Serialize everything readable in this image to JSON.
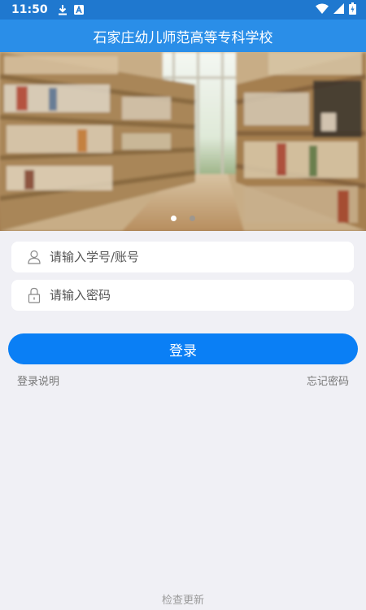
{
  "status_bar": {
    "time": "11:50",
    "icons": [
      "download-icon",
      "a-badge-icon",
      "wifi-icon",
      "signal-icon",
      "battery-icon"
    ]
  },
  "app_bar": {
    "title": "石家庄幼儿师范高等专科学校"
  },
  "banner": {
    "slide_count": 2,
    "active_slide": 0
  },
  "login_form": {
    "account_placeholder": "请输入学号/账号",
    "account_value": "",
    "password_placeholder": "请输入密码",
    "password_value": "",
    "login_button": "登录",
    "login_help_link": "登录说明",
    "forgot_password_link": "忘记密码"
  },
  "footer": {
    "check_update": "检查更新"
  },
  "colors": {
    "status_bar": "#1f78cf",
    "app_bar": "#2a8ee8",
    "primary_button": "#0a7ff5",
    "background": "#f0f0f5"
  }
}
